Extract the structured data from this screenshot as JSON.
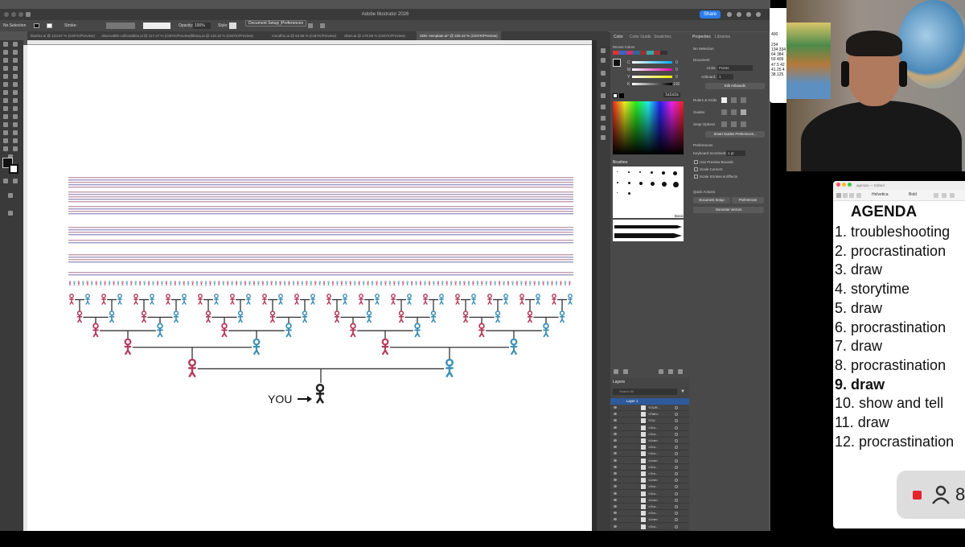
{
  "illustrator": {
    "title": "Adobe Illustrator 2026",
    "share_label": "Share",
    "control": {
      "selection": "No Selection",
      "stroke_label": "Stroke:",
      "opacity_label": "Opacity:",
      "opacity_value": "100%",
      "style_label": "Style:",
      "doc_setup": "Document Setup",
      "preferences": "Preferences"
    },
    "tabs": [
      "bluefox.ai @ 123.57 % (CMYK/Preview)",
      "observable-collectables.ai @ 117.47 % (CMYK/Preview)",
      "library.ai @ 116.32 % (CMYK/Preview)",
      "mondfox.ai @ 64.65 % (CMYK/Preview)",
      "vibes.ai @ 178.85 % (CMYK/Preview)",
      "SDE--template.ai* @ 226.42 % (CMYK/Preview)"
    ],
    "canvas": {
      "you_label": "YOU"
    },
    "color_panel": {
      "tabs": [
        "Color",
        "Color Guide",
        "Swatches"
      ],
      "recent": "Recent Colors",
      "channels": [
        {
          "name": "C",
          "value": "0"
        },
        {
          "name": "M",
          "value": "0"
        },
        {
          "name": "Y",
          "value": "0"
        },
        {
          "name": "K",
          "value": "100"
        }
      ],
      "hex": "1a1a1a",
      "brushes_title": "Brushes",
      "basic": "Basic"
    },
    "properties": {
      "tabs": [
        "Properties",
        "Libraries"
      ],
      "no_selection": "No Selection",
      "document": "Document",
      "units_label": "Units:",
      "units_value": "Points",
      "artboard_label": "Artboard:",
      "artboard_value": "1",
      "edit_artboards": "Edit Artboards",
      "rulers_grids": "Rulers & Grids",
      "guides": "Guides",
      "snap_options": "Snap Options",
      "smart_guides": "Smart Guides Preferences...",
      "preferences": "Preferences",
      "keyboard_increment_label": "Keyboard Increment:",
      "keyboard_increment_value": "1 pt",
      "checkboxes": [
        "Use Preview Bounds",
        "Scale Corners",
        "Scale Strokes & Effects"
      ],
      "quick_actions": "Quick Actions",
      "doc_setup": "Document Setup",
      "prefs_btn": "Preferences",
      "generate_vectors": "Generate Vectors"
    },
    "layers": {
      "title": "Layers",
      "search_placeholder": "Search All",
      "layer_name": "Layer 1",
      "items": [
        "YOUR...",
        "<Path>",
        "YOU",
        "<Gro...",
        "<Gro...",
        "<Line>",
        "<Gro...",
        "<Gro...",
        "<Line>",
        "<Gro...",
        "<Gro...",
        "<Line>",
        "<Gro...",
        "<Gro...",
        "<Line>",
        "<Gro...",
        "<Gro...",
        "<Line>",
        "<Gro...",
        "<Line>"
      ]
    }
  },
  "spreadsheet": {
    "lines": [
      "400",
      "",
      "234",
      "134 334",
      "64 384",
      "59 409",
      "47.5 42",
      "41.25 4",
      "38.125"
    ]
  },
  "agenda": {
    "window_title": "agenda — Edited",
    "font": "Helvetica",
    "weight": "Bold",
    "title": "AGENDA",
    "items": [
      {
        "text": "1. troubleshooting",
        "bold": false
      },
      {
        "text": "2. procrastination",
        "bold": false
      },
      {
        "text": "3. draw",
        "bold": false
      },
      {
        "text": "4. storytime",
        "bold": false
      },
      {
        "text": "5. draw",
        "bold": false
      },
      {
        "text": "6. procrastination",
        "bold": false
      },
      {
        "text": "7. draw",
        "bold": false
      },
      {
        "text": "8. procrastination",
        "bold": false
      },
      {
        "text": "9. draw",
        "bold": true
      },
      {
        "text": "10. show and tell",
        "bold": false
      },
      {
        "text": "11. draw",
        "bold": false
      },
      {
        "text": "12. procrastination",
        "bold": false
      }
    ]
  },
  "recording": {
    "count": "8"
  },
  "colors": {
    "male": "#3b8fb4",
    "female": "#b23a5a",
    "line": "#333333"
  }
}
